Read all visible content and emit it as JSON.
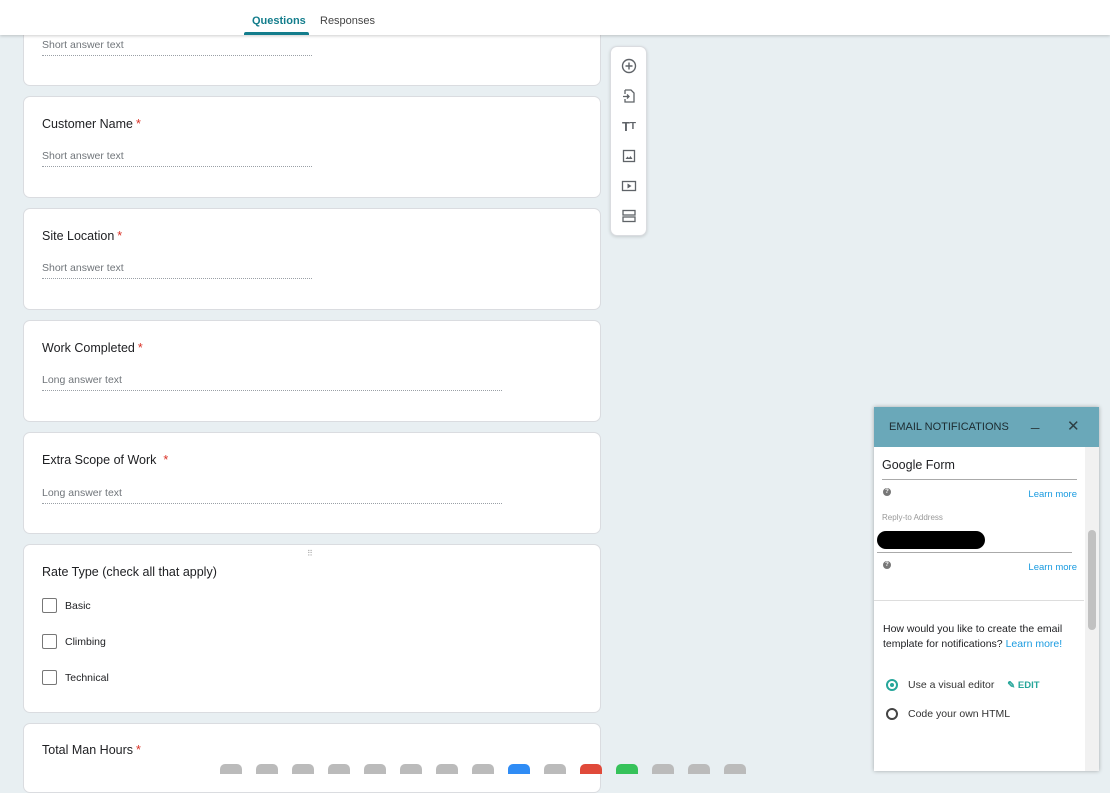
{
  "header": {
    "tabs": [
      {
        "label": "Questions",
        "active": true
      },
      {
        "label": "Responses",
        "active": false
      }
    ]
  },
  "accent": "#137d8c",
  "questions": [
    {
      "title": "",
      "required": false,
      "answer_placeholder": "Short answer text"
    },
    {
      "title": "Customer Name",
      "required": true,
      "answer_placeholder": "Short answer text"
    },
    {
      "title": "Site Location",
      "required": true,
      "answer_placeholder": "Short answer text"
    },
    {
      "title": "Work Completed",
      "required": true,
      "answer_placeholder": "Long answer text"
    },
    {
      "title": "Extra Scope of Work",
      "required": true,
      "answer_placeholder": "Long answer text"
    },
    {
      "title": "Rate Type (check all that apply)",
      "required": false,
      "options": [
        "Basic",
        "Climbing",
        "Technical"
      ]
    },
    {
      "title": "Total Man Hours",
      "required": true
    }
  ],
  "required_mark": "*",
  "toolbar": {
    "icons": [
      "add-question-icon",
      "import-questions-icon",
      "title-text-icon",
      "image-icon",
      "video-icon",
      "section-icon"
    ]
  },
  "email_panel": {
    "title": "EMAIL NOTIFICATIONS",
    "minimize": "_",
    "close": "✕",
    "sender_name": "Google Form",
    "learn_more": "Learn more",
    "reply_to_label": "Reply-to Address",
    "template_question": "How would you like to create the email template for notifications?",
    "template_link": "Learn more!",
    "options": [
      {
        "label": "Use a visual editor",
        "selected": true
      },
      {
        "label": "Code your own HTML",
        "selected": false
      }
    ],
    "edit_label": "EDIT"
  }
}
